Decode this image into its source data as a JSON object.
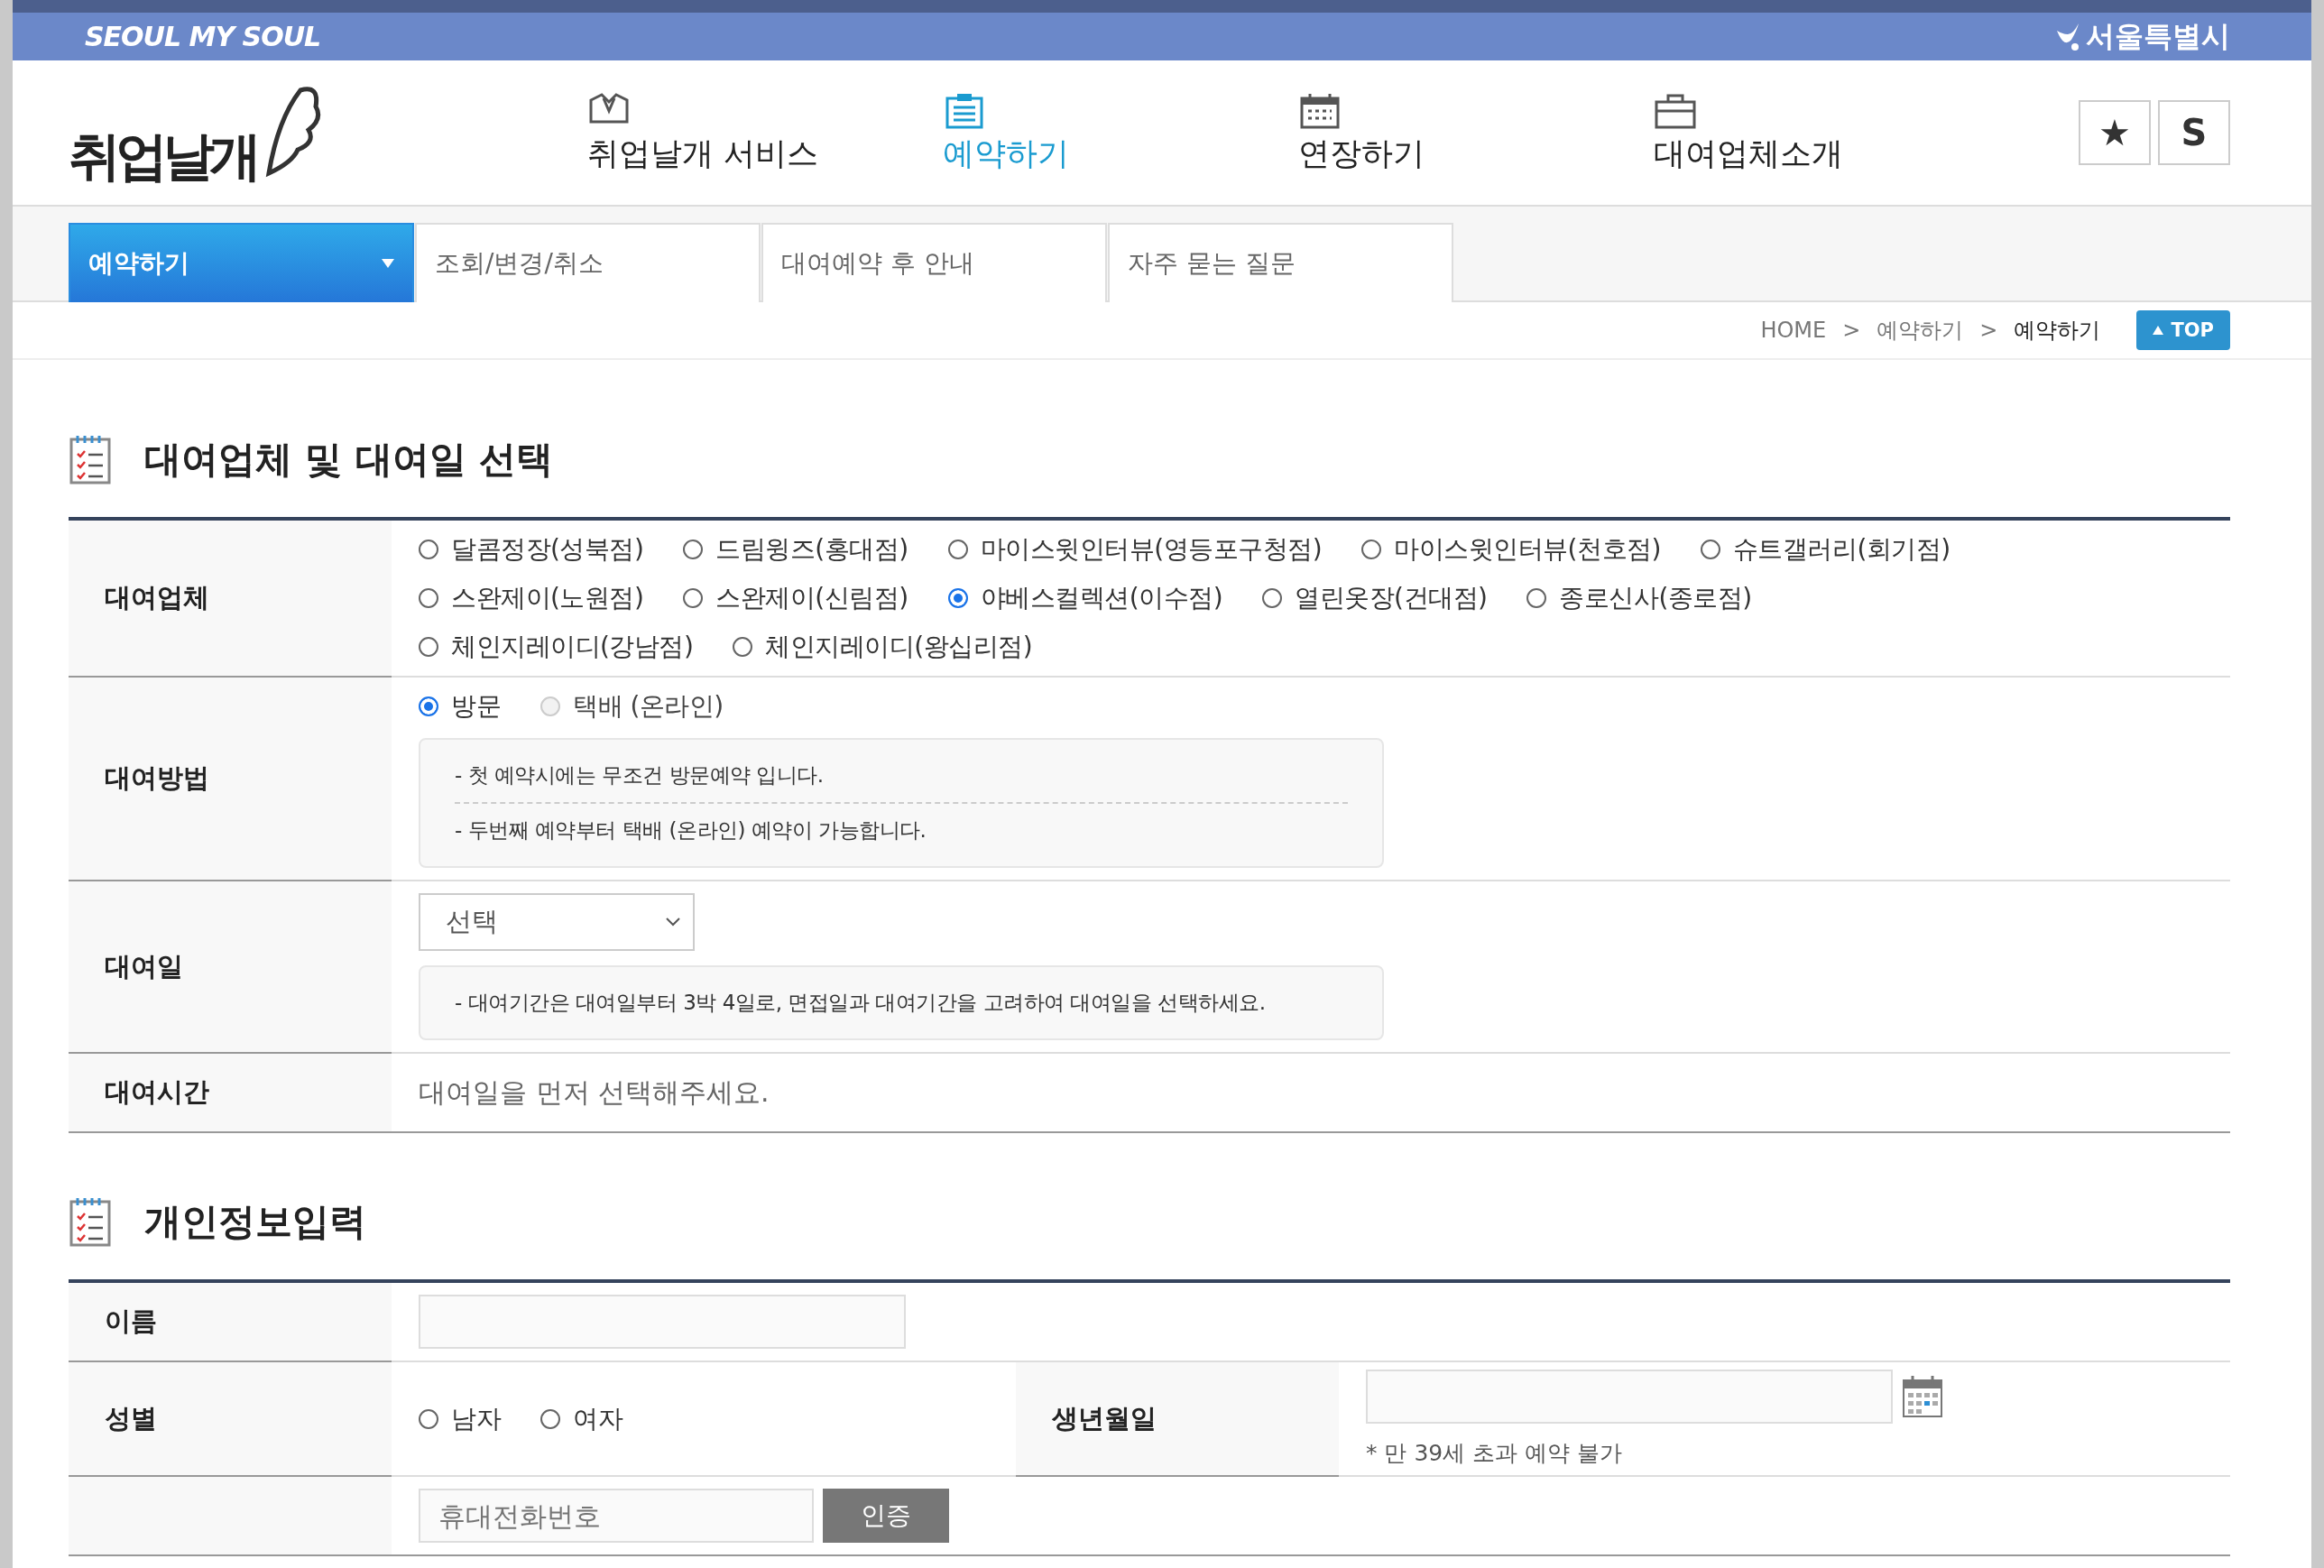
{
  "top_bar": {
    "brand": "SEOUL MY SOUL",
    "city": "서울특별시"
  },
  "header": {
    "logo": "취업날개",
    "nav": [
      {
        "label": "취업날개 서비스",
        "kind": "hanger",
        "selected": false
      },
      {
        "label": "예약하기",
        "kind": "clipboard",
        "selected": true
      },
      {
        "label": "연장하기",
        "kind": "calendar",
        "selected": false
      },
      {
        "label": "대여업체소개",
        "kind": "briefcase",
        "selected": false
      }
    ],
    "quick_buttons": [
      "★",
      "S"
    ]
  },
  "subnav": {
    "tabs": [
      {
        "label": "예약하기",
        "selected": true
      },
      {
        "label": "조회/변경/취소",
        "selected": false
      },
      {
        "label": "대여예약 후 안내",
        "selected": false
      },
      {
        "label": "자주 묻는 질문",
        "selected": false
      }
    ]
  },
  "breadcrumb": {
    "items": [
      "HOME",
      "예약하기",
      "예약하기"
    ],
    "separator": ">",
    "top_button": "TOP"
  },
  "sections": [
    {
      "title": "대여업체 및 대여일 선택",
      "rows": [
        {
          "label": "대여업체",
          "fields": [
            {
              "kind": "radios",
              "options": [
                {
                  "label": "달콤정장(성북점)",
                  "selected": false,
                  "disabled": false
                },
                {
                  "label": "드림윙즈(홍대점)",
                  "selected": false,
                  "disabled": false
                },
                {
                  "label": "마이스윗인터뷰(영등포구청점)",
                  "selected": false,
                  "disabled": false
                },
                {
                  "label": "마이스윗인터뷰(천호점)",
                  "selected": false,
                  "disabled": false
                },
                {
                  "label": "슈트갤러리(회기점)",
                  "selected": false,
                  "disabled": false
                },
                {
                  "label": "스완제이(노원점)",
                  "selected": false,
                  "disabled": false
                },
                {
                  "label": "스완제이(신림점)",
                  "selected": false,
                  "disabled": false
                },
                {
                  "label": "야베스컬렉션(이수점)",
                  "selected": true,
                  "disabled": false
                },
                {
                  "label": "열린옷장(건대점)",
                  "selected": false,
                  "disabled": false
                },
                {
                  "label": "종로신사(종로점)",
                  "selected": false,
                  "disabled": false
                },
                {
                  "label": "체인지레이디(강남점)",
                  "selected": false,
                  "disabled": false
                },
                {
                  "label": "체인지레이디(왕십리점)",
                  "selected": false,
                  "disabled": false
                }
              ]
            }
          ]
        },
        {
          "label": "대여방법",
          "fields": [
            {
              "kind": "radios",
              "options": [
                {
                  "label": "방문",
                  "selected": true,
                  "disabled": false
                },
                {
                  "label": "택배 (온라인)",
                  "selected": false,
                  "disabled": true
                }
              ]
            },
            {
              "kind": "note",
              "lines": [
                "- 첫 예약시에는 무조건 방문예약 입니다.",
                "- 두번째 예약부터 택배 (온라인) 예약이 가능합니다."
              ]
            }
          ]
        },
        {
          "label": "대여일",
          "fields": [
            {
              "kind": "select",
              "value": "선택"
            },
            {
              "kind": "note",
              "lines": [
                "- 대여기간은 대여일부터 3박 4일로, 면접일과 대여기간을 고려하여 대여일을 선택하세요."
              ]
            }
          ]
        },
        {
          "label": "대여시간",
          "fields": [
            {
              "kind": "text",
              "text": "대여일을 먼저 선택해주세요."
            }
          ]
        }
      ]
    },
    {
      "title": "개인정보입력",
      "rows": [
        {
          "label": "이름",
          "fields": [
            {
              "kind": "input"
            }
          ]
        },
        {
          "label": "성별",
          "fields": [
            {
              "kind": "radios",
              "options": [
                {
                  "label": "남자",
                  "selected": false,
                  "disabled": false
                },
                {
                  "label": "여자",
                  "selected": false,
                  "disabled": false
                }
              ]
            }
          ],
          "side": {
            "label": "생년월일",
            "fields": [
              {
                "kind": "date",
                "hint": "* 만 39세 초과 예약 불가"
              }
            ]
          }
        },
        {
          "fields": [
            {
              "kind": "input_button",
              "placeholder": "휴대전화번호",
              "button": "인증"
            }
          ]
        }
      ]
    }
  ]
}
